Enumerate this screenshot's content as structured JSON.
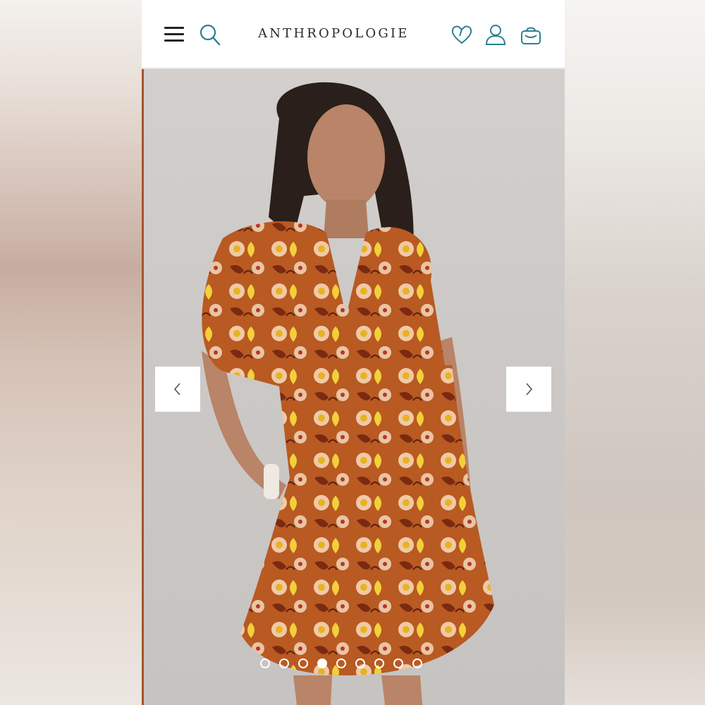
{
  "header": {
    "brand": "ANTHROPOLOGIE",
    "icons": {
      "menu": "hamburger-menu-icon",
      "search": "search-icon",
      "wishlist": "heart-icon",
      "account": "user-icon",
      "bag": "shopping-bag-icon"
    }
  },
  "colors": {
    "accent": "#2b7f96",
    "text": "#222222",
    "header_bg": "#ffffff"
  },
  "gallery": {
    "image_subject": "product-photo-floral-dress",
    "prev_icon": "chevron-left-icon",
    "next_icon": "chevron-right-icon",
    "slide_count": 9,
    "active_slide": 4
  }
}
